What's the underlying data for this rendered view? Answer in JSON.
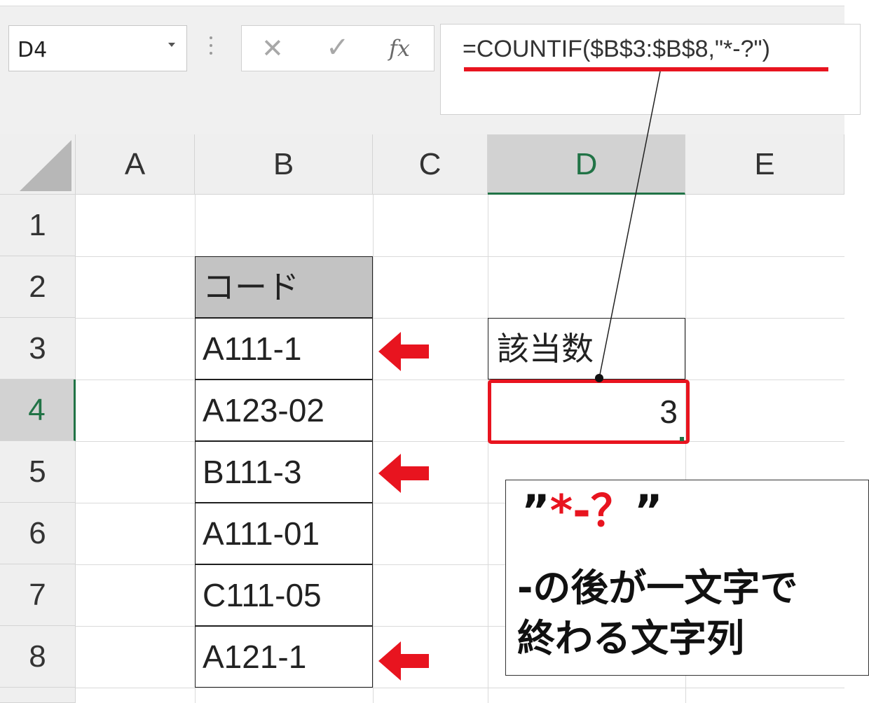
{
  "formula_bar": {
    "name_box": "D4",
    "cancel_icon": "✕",
    "enter_icon": "✓",
    "fx_icon": "fx",
    "formula": "=COUNTIF($B$3:$B$8,\"*-?\")"
  },
  "columns": [
    "A",
    "B",
    "C",
    "D",
    "E"
  ],
  "rows": [
    "1",
    "2",
    "3",
    "4",
    "5",
    "6",
    "7",
    "8"
  ],
  "cells": {
    "B2": "コード",
    "B3": "A111-1",
    "B4": "A123-02",
    "B5": "B111-3",
    "B6": "A111-01",
    "B7": "C111-05",
    "B8": "A121-1",
    "D3": "該当数",
    "D4": "3"
  },
  "selected_cell": "D4",
  "arrows_point_to_rows": [
    "3",
    "5",
    "8"
  ],
  "note": {
    "pattern_open": "”",
    "pattern_body": "*-？",
    "pattern_close": "”",
    "line1": "-の後が一文字で",
    "line2": "終わる文字列"
  },
  "colors": {
    "accent_red": "#e8141f",
    "excel_green": "#217346",
    "header_fill": "#c3c3c3"
  }
}
